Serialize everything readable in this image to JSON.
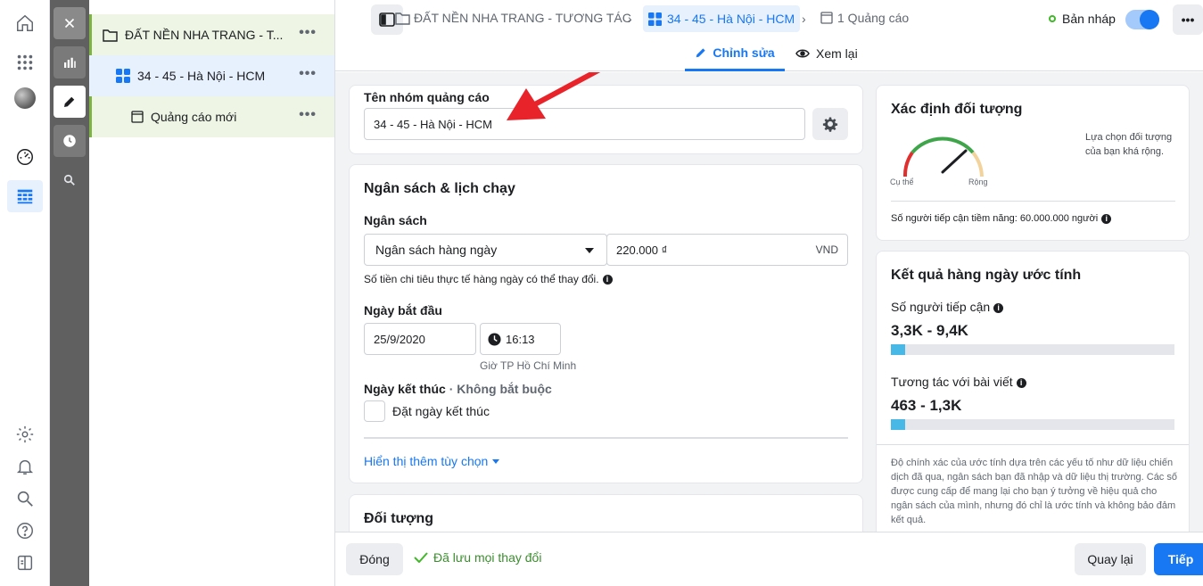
{
  "campaign": {
    "name": "ĐẤT NỀN NHA TRANG - TƯƠNG TÁC",
    "name_short": "ĐẤT NỀN NHA TRANG - T..."
  },
  "adset": {
    "name": "34 - 45 - Hà Nội - HCM"
  },
  "ad": {
    "name": "Quảng cáo mới",
    "crumb": "1 Quảng cáo"
  },
  "status": {
    "draft_label": "Bản nháp"
  },
  "tabs": {
    "edit": "Chỉnh sửa",
    "view": "Xem lại"
  },
  "adset_name_card": {
    "label": "Tên nhóm quảng cáo",
    "value": "34 - 45 - Hà Nội - HCM"
  },
  "budget": {
    "section_title": "Ngân sách & lịch chạy",
    "label": "Ngân sách",
    "type": "Ngân sách hàng ngày",
    "amount": "220.000 ₫",
    "currency": "VND",
    "note": "Số tiền chi tiêu thực tế hàng ngày có thể thay đổi.",
    "start_label": "Ngày bắt đầu",
    "start_date": "25/9/2020",
    "start_time": "16:13",
    "timezone": "Giờ TP Hồ Chí Minh",
    "end_label": "Ngày kết thúc",
    "end_optional": " · Không bắt buộc",
    "end_checkbox": "Đặt ngày kết thúc",
    "more_options": "Hiển thị thêm tùy chọn"
  },
  "audience_section": {
    "title": "Đối tượng"
  },
  "audience_def": {
    "title": "Xác định đối tượng",
    "gauge_left": "Cụ thể",
    "gauge_right": "Rộng",
    "description": "Lựa chọn đối tượng của bạn khá rộng.",
    "potential_reach": "Số người tiếp cận tiềm năng: 60.000.000 người"
  },
  "estimates": {
    "title": "Kết quả hàng ngày ước tính",
    "reach_label": "Số người tiếp cận",
    "reach_value": "3,3K - 9,4K",
    "reach_fill": 0.05,
    "engage_label": "Tương tác với bài viết",
    "engage_value": "463 - 1,3K",
    "engage_fill": 0.05,
    "disclaimer": "Độ chính xác của ước tính dựa trên các yếu tố như dữ liệu chiến dịch đã qua, ngân sách bạn đã nhập và dữ liệu thị trường. Các số được cung cấp để mang lại cho bạn ý tưởng về hiệu quả cho ngân sách của mình, nhưng đó chỉ là ước tính và không bảo đảm kết quả."
  },
  "footer": {
    "close": "Đóng",
    "saved": "Đã lưu mọi thay đổi",
    "back": "Quay lại",
    "next": "Tiếp"
  },
  "colors": {
    "accent": "#1877f2",
    "draft_green": "#42b72a",
    "annotation_red": "#e8232a"
  }
}
